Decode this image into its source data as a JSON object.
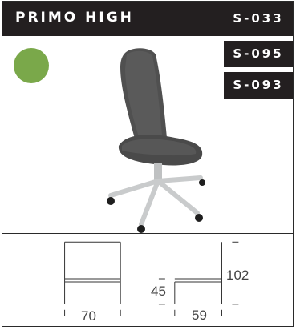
{
  "product": {
    "name": "PRIMO HIGH",
    "codes": [
      "S-033",
      "S-095",
      "S-093"
    ],
    "swatch_color": "#7aa84a",
    "chair_color": "#4a4a4a",
    "base_color": "#c9cbcc"
  },
  "dimensions": {
    "width": "70",
    "seat_height": "45",
    "depth": "59",
    "height": "102"
  }
}
